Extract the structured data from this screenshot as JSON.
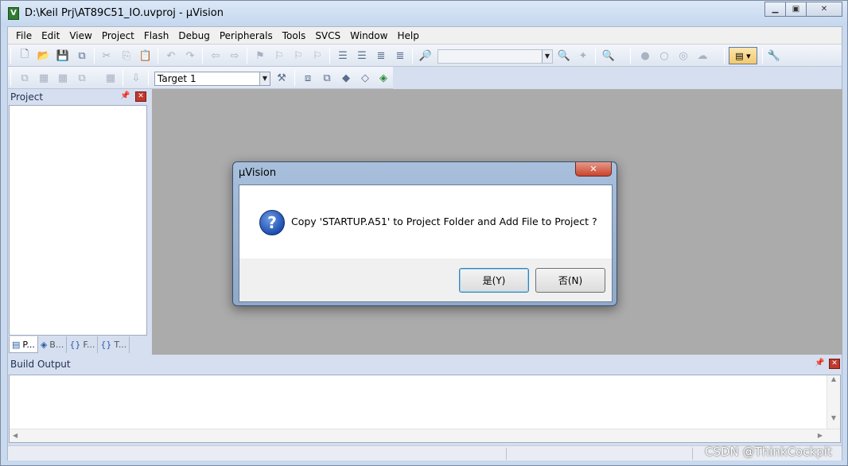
{
  "window": {
    "title": "D:\\Keil Prj\\AT89C51_IO.uvproj - µVision",
    "app_icon": "keil-uvision-icon",
    "controls": [
      "minimize-icon",
      "maximize-icon",
      "close-icon"
    ]
  },
  "menu": [
    "File",
    "Edit",
    "View",
    "Project",
    "Flash",
    "Debug",
    "Peripherals",
    "Tools",
    "SVCS",
    "Window",
    "Help"
  ],
  "toolbar": {
    "find_combo_value": "",
    "target_combo_value": "Target 1"
  },
  "project_panel": {
    "title": "Project",
    "tabs": [
      "P...",
      "B...",
      "F...",
      "T..."
    ],
    "tab_icons": [
      "project-tab-icon",
      "books-tab-icon",
      "functions-tab-icon",
      "templates-tab-icon"
    ],
    "tab_glyphs": [
      "▤",
      "◈",
      "{}",
      "{}"
    ]
  },
  "build_output": {
    "title": "Build Output"
  },
  "dialog": {
    "title": "µVision",
    "icon": "question-icon",
    "message": "Copy 'STARTUP.A51' to Project Folder and Add File to Project ?",
    "yes_label": "是(Y)",
    "no_label": "否(N)"
  },
  "watermark": "CSDN @ThinkCockpit",
  "colors": {
    "workspace": "#ababab",
    "frame": "#d6dff0",
    "dialog_accent": "#1d4fb0"
  }
}
